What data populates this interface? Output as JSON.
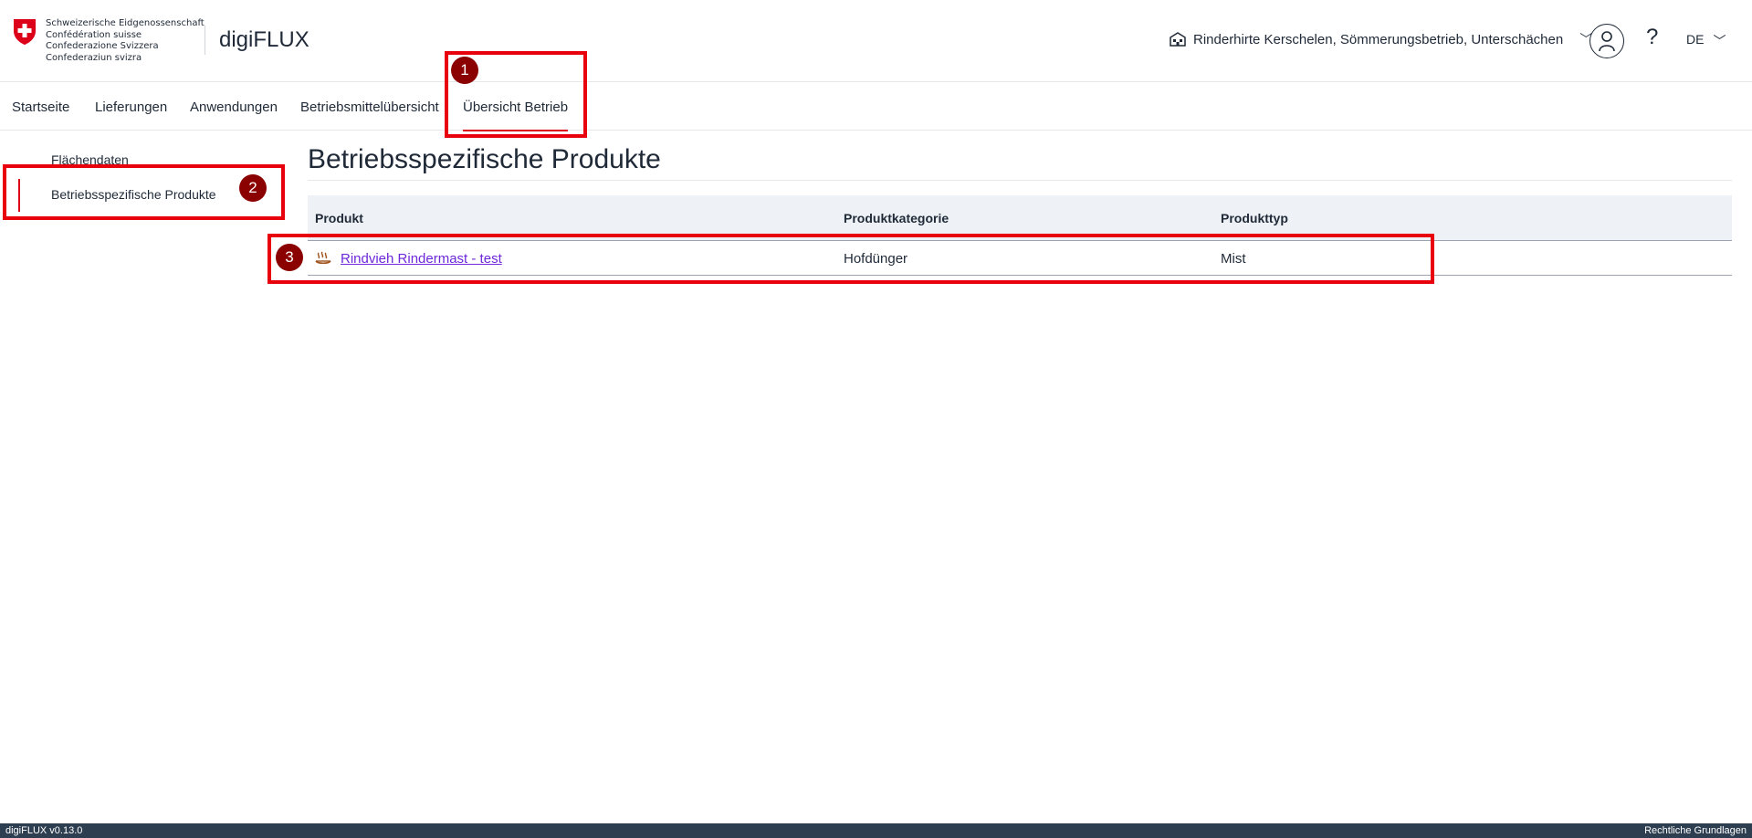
{
  "header": {
    "confederation_lines": [
      "Schweizerische Eidgenossenschaft",
      "Confédération suisse",
      "Confederazione Svizzera",
      "Confederaziun svizra"
    ],
    "app_name": "digiFLUX",
    "farm_selector": "Rinderhirte Kerschelen, Sömmerungsbetrieb, Unterschächen",
    "help": "?",
    "language": "DE"
  },
  "nav": {
    "items": [
      "Startseite",
      "Lieferungen",
      "Anwendungen",
      "Betriebsmittelübersicht",
      "Übersicht Betrieb"
    ],
    "active": "Übersicht Betrieb"
  },
  "sidebar": {
    "items": [
      "Flächendaten",
      "Betriebsspezifische Produkte"
    ],
    "active": "Betriebsspezifische Produkte"
  },
  "main": {
    "title": "Betriebsspezifische Produkte",
    "table": {
      "columns": [
        "Produkt",
        "Produktkategorie",
        "Produkttyp"
      ],
      "rows": [
        {
          "produkt": "Rindvieh Rindermast - test",
          "kategorie": "Hofdünger",
          "typ": "Mist",
          "icon": "manure-steam-icon"
        }
      ]
    }
  },
  "annotations": {
    "badges": [
      "1",
      "2",
      "3"
    ],
    "color": "#e8000d"
  },
  "footer": {
    "version": "digiFLUX v0.13.0",
    "legal": "Rechtliche Grundlagen"
  },
  "colors": {
    "accent": "#dc0018",
    "link": "#6d28d9",
    "footer_bg": "#2d3e50",
    "table_header_bg": "#eef2f6"
  }
}
